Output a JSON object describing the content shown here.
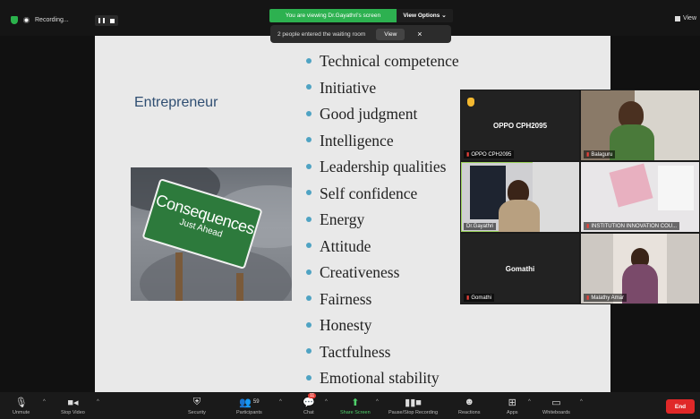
{
  "topbar": {
    "recording_label": "Recording...",
    "viewing_label": "You are viewing Dr.Gayathri's screen",
    "view_options_label": "View Options ⌄",
    "right_label": "View"
  },
  "waiting_notice": {
    "text": "2 people entered the waiting room",
    "view_label": "View",
    "close": "×"
  },
  "slide": {
    "title": "Entrepreneur",
    "sign_big": "Consequences",
    "sign_small": "Just Ahead",
    "bullets": [
      "Technical competence",
      "Initiative",
      "Good judgment",
      "Intelligence",
      "Leadership qualities",
      "Self confidence",
      "Energy",
      "Attitude",
      "Creativeness",
      "Fairness",
      "Honesty",
      "Tactfulness",
      "Emotional stability"
    ]
  },
  "participants": [
    {
      "name": "OPPO CPH2095",
      "center_label": "OPPO CPH2095"
    },
    {
      "name": "Balaguru",
      "center_label": ""
    },
    {
      "name": "Dr.Gayathri",
      "center_label": ""
    },
    {
      "name": "INSTITUTION INNOVATION COU...",
      "center_label": ""
    },
    {
      "name": "Gomathi",
      "center_label": "Gomathi"
    },
    {
      "name": "Malathy Amar",
      "center_label": ""
    }
  ],
  "toolbar": {
    "unmute": "Unmute",
    "stop_video": "Stop Video",
    "security": "Security",
    "participants": "Participants",
    "participant_count": "59",
    "chat": "Chat",
    "chat_badge": "11",
    "share_screen": "Share Screen",
    "record": "Pause/Stop Recording",
    "reactions": "Reactions",
    "apps": "Apps",
    "whiteboards": "Whiteboards",
    "end": "End"
  },
  "colors": {
    "accent_green": "#2db150",
    "end_red": "#e02828",
    "bullet_blue": "#4fa3c3",
    "title_blue": "#2f4e72"
  }
}
